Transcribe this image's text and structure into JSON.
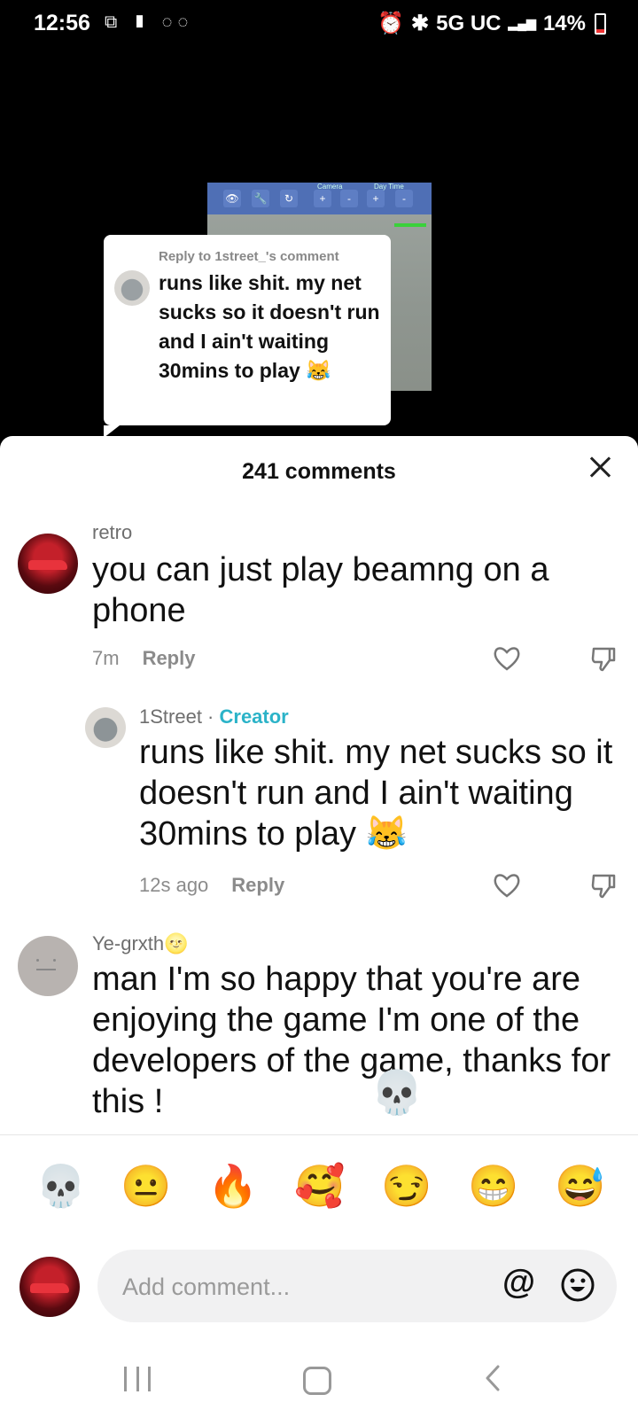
{
  "status_bar": {
    "time": "12:56",
    "left_icons": "⧉ ▮ ◌◌",
    "alarm_icon": "⏰",
    "bluetooth_icon": "✱",
    "network": "5G UC",
    "signal": "▂▄▆",
    "battery": "14%"
  },
  "video": {
    "reply_header": "Reply to 1street_'s comment",
    "reply_text": "runs like shit. my net sucks so it doesn't run and I ain't waiting 30mins to play 😹",
    "toolbar_labels": [
      "Camera",
      "Day Time"
    ]
  },
  "sheet": {
    "title": "241 comments"
  },
  "comments": [
    {
      "username": "retro",
      "text": "you can just play beamng on a phone",
      "time": "7m",
      "reply_label": "Reply"
    },
    {
      "username": "1Street",
      "creator_badge": "Creator",
      "text": "runs like shit. my net sucks so it doesn't run and I ain't waiting 30mins to play 😹",
      "time": "12s ago",
      "reply_label": "Reply"
    },
    {
      "username": "Ye-grxth🌝",
      "text": "man I'm so happy that you're are enjoying the game I'm one of the developers of the game, thanks for this !",
      "overlay_emoji": "💀"
    }
  ],
  "emoji_bar": [
    "💀",
    "😐",
    "🔥",
    "🥰",
    "😏",
    "😁",
    "😅"
  ],
  "composer": {
    "placeholder": "Add comment...",
    "at_symbol": "@"
  },
  "colors": {
    "creator": "#2bb3c8",
    "sheet_bg": "#ffffff",
    "input_bg": "#f1f1f2"
  }
}
